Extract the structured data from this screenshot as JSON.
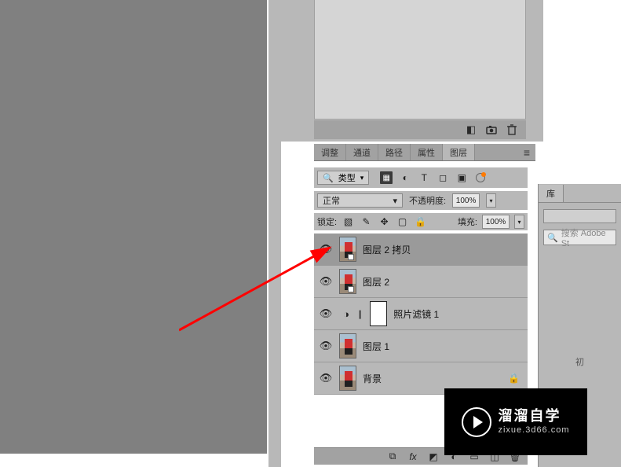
{
  "tabs": {
    "t1": "调整",
    "t2": "通道",
    "t3": "路径",
    "t4": "属性",
    "t5": "图层"
  },
  "typeFilter": {
    "label": "类型"
  },
  "blend": {
    "mode": "正常",
    "opacityLabel": "不透明度:",
    "opacityValue": "100%"
  },
  "lock": {
    "label": "锁定:",
    "fillLabel": "填充:",
    "fillValue": "100%"
  },
  "layers": [
    {
      "name": "图层 2 拷贝"
    },
    {
      "name": "图层 2"
    },
    {
      "name": "照片滤镜 1"
    },
    {
      "name": "图层 1"
    },
    {
      "name": "背景"
    }
  ],
  "library": {
    "tab": "库",
    "searchPlaceholder": "搜索 Adobe St",
    "center": "初"
  },
  "watermark": {
    "main": "溜溜自学",
    "sub": "zixue.3d66.com"
  }
}
